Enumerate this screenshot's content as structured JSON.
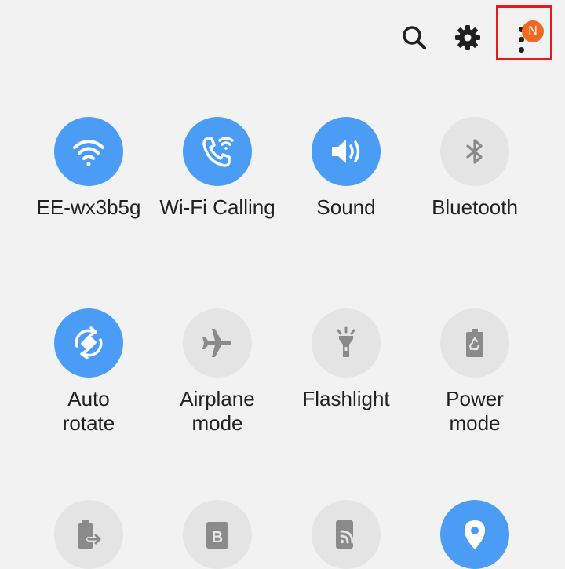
{
  "top_bar": {
    "icons": [
      "search-icon",
      "gear-icon",
      "more-options-icon"
    ],
    "notification_badge": "N"
  },
  "colors": {
    "background": "#f2f2f2",
    "tile_on": "#4a9cf5",
    "tile_off": "#e4e4e4",
    "icon_off": "#8a8a8a",
    "badge": "#f26a21",
    "highlight_box": "#e21b1b"
  },
  "tiles": [
    {
      "label": "EE-wx3b5g",
      "icon": "wifi-icon",
      "state": "on"
    },
    {
      "label": "Wi-Fi Calling",
      "icon": "wifi-calling-icon",
      "state": "on"
    },
    {
      "label": "Sound",
      "icon": "sound-icon",
      "state": "on"
    },
    {
      "label": "Bluetooth",
      "icon": "bluetooth-icon",
      "state": "off"
    },
    {
      "label": "Auto\nrotate",
      "icon": "auto-rotate-icon",
      "state": "on"
    },
    {
      "label": "Airplane\nmode",
      "icon": "airplane-icon",
      "state": "off"
    },
    {
      "label": "Flashlight",
      "icon": "flashlight-icon",
      "state": "off"
    },
    {
      "label": "Power\nmode",
      "icon": "power-mode-icon",
      "state": "off"
    },
    {
      "label": "",
      "icon": "battery-share-icon",
      "state": "off"
    },
    {
      "label": "",
      "icon": "bixby-routines-icon",
      "state": "off"
    },
    {
      "label": "",
      "icon": "smart-view-icon",
      "state": "off"
    },
    {
      "label": "",
      "icon": "location-icon",
      "state": "on"
    }
  ]
}
